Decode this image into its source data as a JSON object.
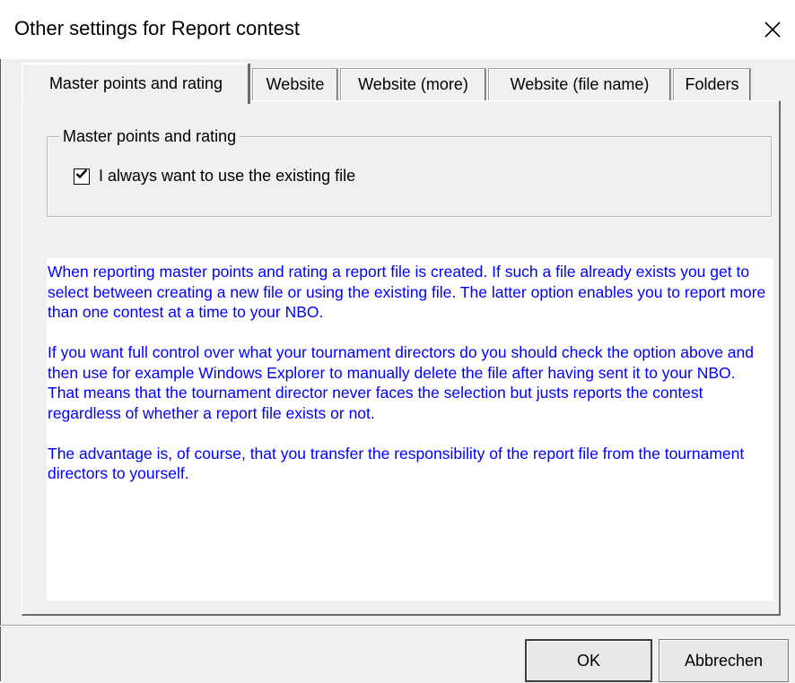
{
  "window": {
    "title": "Other settings for Report contest",
    "close_glyph": "✕"
  },
  "tabs": [
    {
      "label": "Master points and rating",
      "active": true
    },
    {
      "label": "Website",
      "active": false
    },
    {
      "label": "Website (more)",
      "active": false
    },
    {
      "label": "Website (file name)",
      "active": false
    },
    {
      "label": "Folders",
      "active": false
    }
  ],
  "group": {
    "legend": "Master points and rating",
    "checkbox_label": "I always want to use the existing file",
    "checkbox_checked": true
  },
  "info": {
    "paragraphs": [
      "When reporting master points and rating a report file is created. If such a file already exists you get to select between creating a new file or using the existing file. The latter option enables you to report more than one contest at a time to your NBO.",
      "If you want full control over what your tournament directors do you should check the option above and then use for example Windows Explorer to manually delete the file after having sent it to your NBO. That means that the tournament director never faces the selection but justs reports the contest regardless of whether a report file exists or not.",
      "The advantage is, of course, that you transfer the responsibility of the report file from the tournament directors to yourself."
    ],
    "text_color": "#0000ff"
  },
  "buttons": {
    "ok": "OK",
    "cancel": "Abbrechen"
  },
  "icons": {
    "close": "close-icon",
    "check": "checkmark-icon"
  }
}
